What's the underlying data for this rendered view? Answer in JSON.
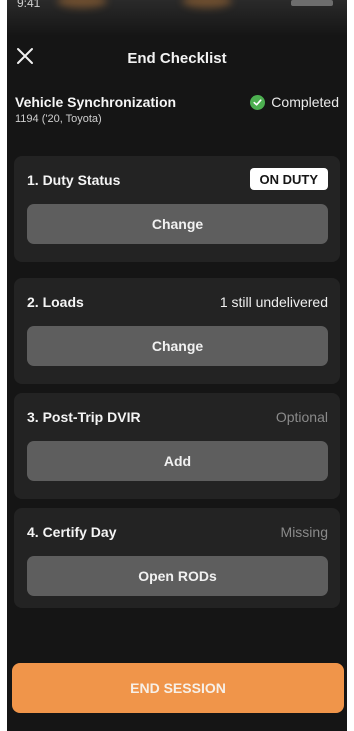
{
  "status_bar": {
    "time": "9:41"
  },
  "header": {
    "title": "End Checklist"
  },
  "vehicle": {
    "name": "Vehicle Synchronization",
    "detail": "1194 ('20, Toyota)",
    "status": "Completed"
  },
  "steps": [
    {
      "label": "1. Duty Status",
      "badge": "ON DUTY",
      "button": "Change"
    },
    {
      "label": "2. Loads",
      "note": "1 still undelivered",
      "button": "Change"
    },
    {
      "label": "3. Post-Trip DVIR",
      "note": "Optional",
      "button": "Add"
    },
    {
      "label": "4. Certify Day",
      "note": "Missing",
      "button": "Open RODs"
    }
  ],
  "footer": {
    "end_session_label": "END SESSION"
  },
  "colors": {
    "accent": "#f0954a",
    "completed": "#4caf50",
    "muted_note": "#8a8a8a"
  }
}
